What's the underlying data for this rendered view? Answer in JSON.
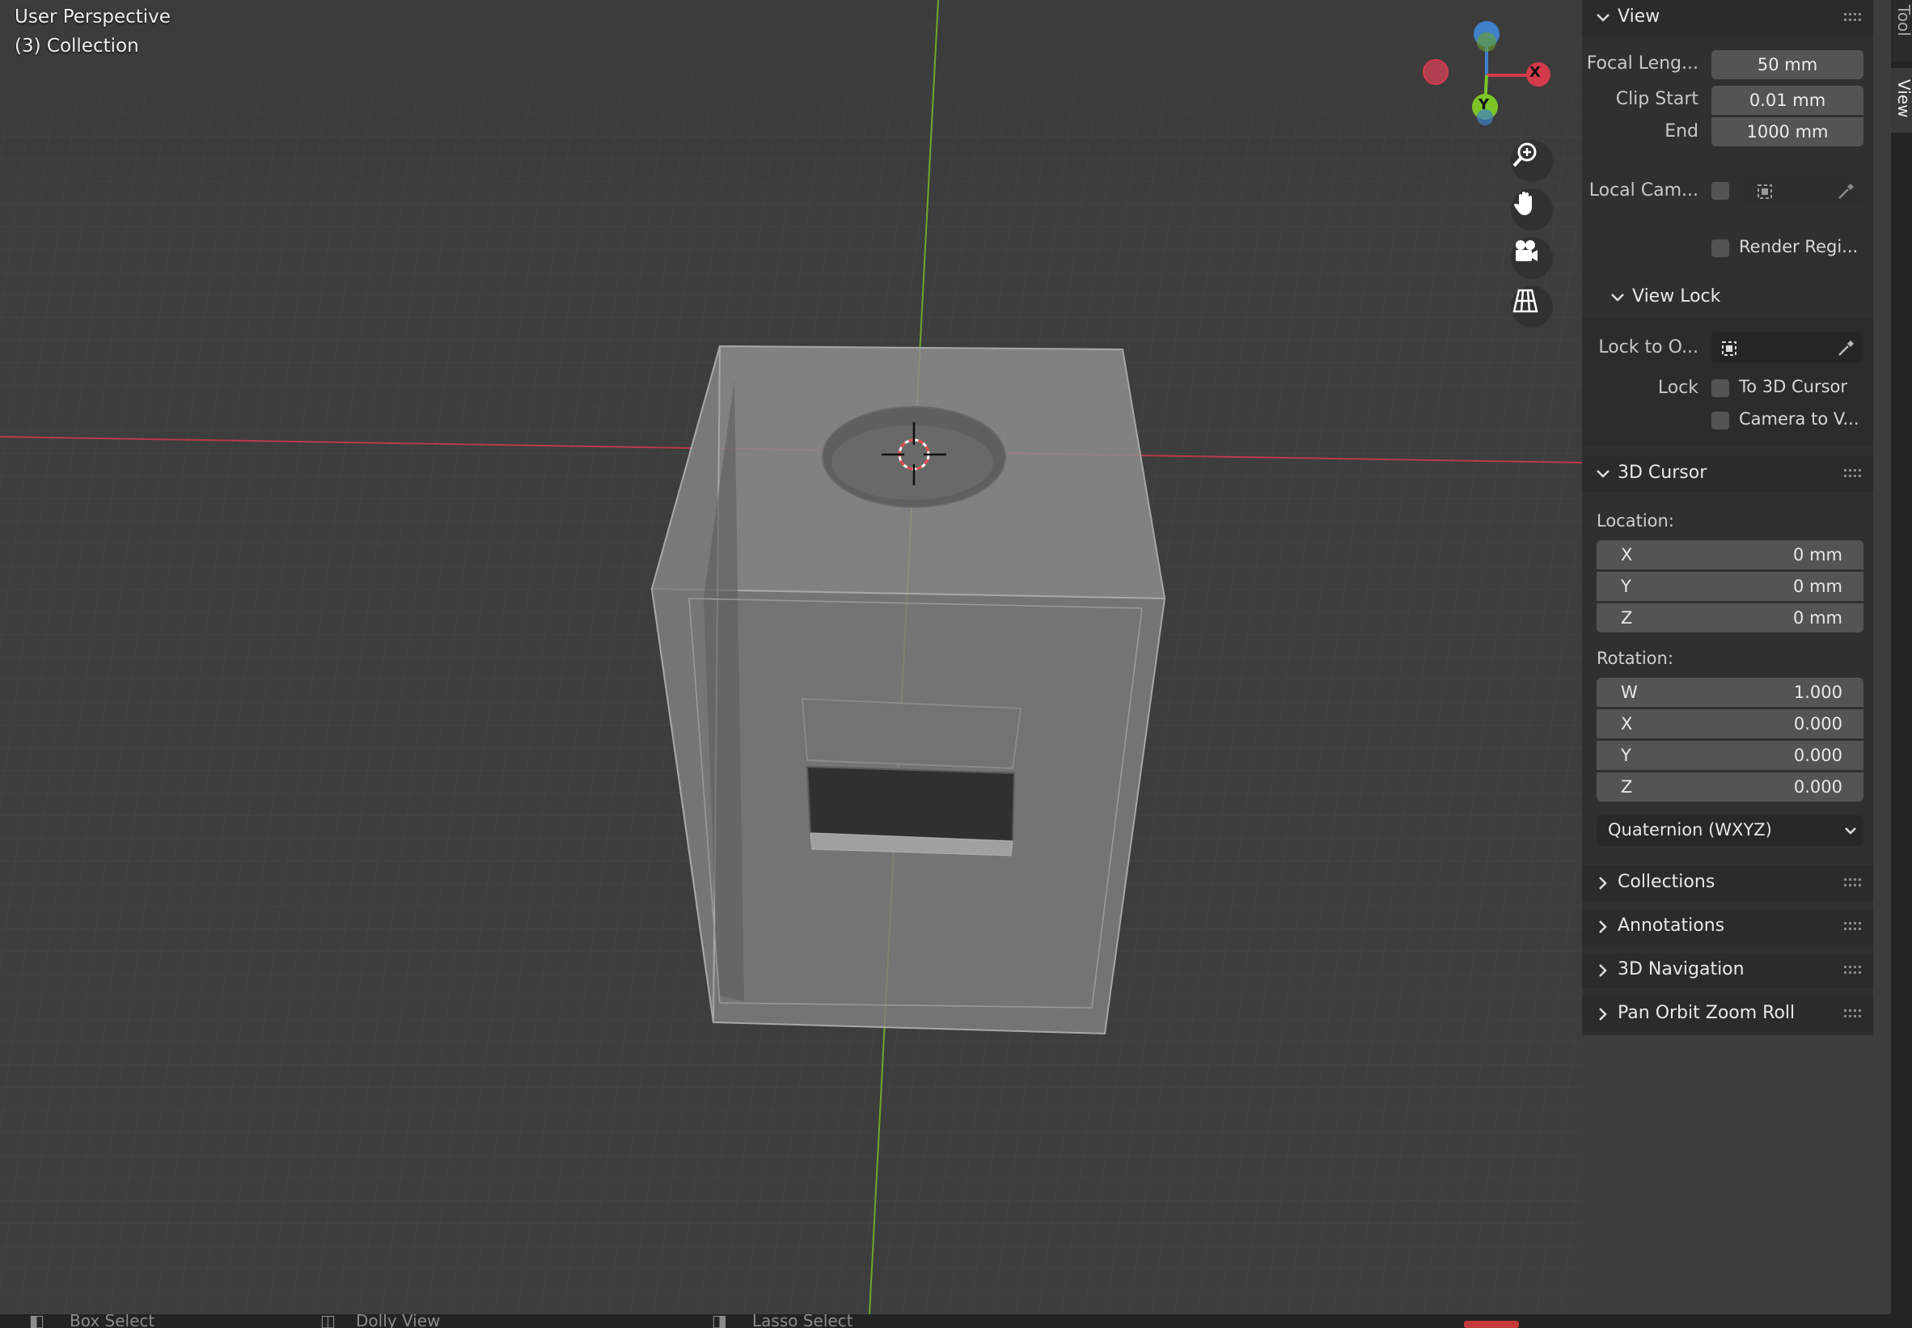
{
  "viewport": {
    "title": "User Perspective",
    "collection": "(3) Collection",
    "gizmo": {
      "x_label": "X",
      "y_label": "Y"
    },
    "nav_icons": [
      "zoom-icon",
      "hand-pan-icon",
      "camera-icon",
      "grid-ortho-icon"
    ]
  },
  "view": {
    "header": "View",
    "focal_label": "Focal Leng...",
    "focal_value": "50 mm",
    "clip_start_label": "Clip Start",
    "clip_start_value": "0.01 mm",
    "end_label": "End",
    "end_value": "1000 mm",
    "local_cam_label": "Local Cam...",
    "render_region_label": "Render Regi..."
  },
  "view_lock": {
    "header": "View Lock",
    "lock_to_label": "Lock to O...",
    "lock_label": "Lock",
    "to_3d_cursor": "To 3D Cursor",
    "camera_to_view": "Camera to V..."
  },
  "cursor": {
    "header": "3D Cursor",
    "location_label": "Location:",
    "loc_x_axis": "X",
    "loc_x": "0 mm",
    "loc_y_axis": "Y",
    "loc_y": "0 mm",
    "loc_z_axis": "Z",
    "loc_z": "0 mm",
    "rotation_label": "Rotation:",
    "rot_w_axis": "W",
    "rot_w": "1.000",
    "rot_x_axis": "X",
    "rot_x": "0.000",
    "rot_y_axis": "Y",
    "rot_y": "0.000",
    "rot_z_axis": "Z",
    "rot_z": "0.000",
    "rotation_mode": "Quaternion (WXYZ)"
  },
  "collapsed": {
    "collections": "Collections",
    "annotations": "Annotations",
    "nav3d": "3D Navigation",
    "pan_orbit": "Pan Orbit Zoom Roll"
  },
  "tabs": {
    "tool": "Tool",
    "view": "View"
  },
  "status": {
    "box_select": "Box Select",
    "dolly_view": "Dolly View",
    "lasso_select": "Lasso Select"
  },
  "colors": {
    "x_axis": "#d33b4c",
    "y_axis": "#7cc427",
    "z_axis": "#3f80c8",
    "panel_bg": "#303030",
    "field_bg": "#545454"
  }
}
